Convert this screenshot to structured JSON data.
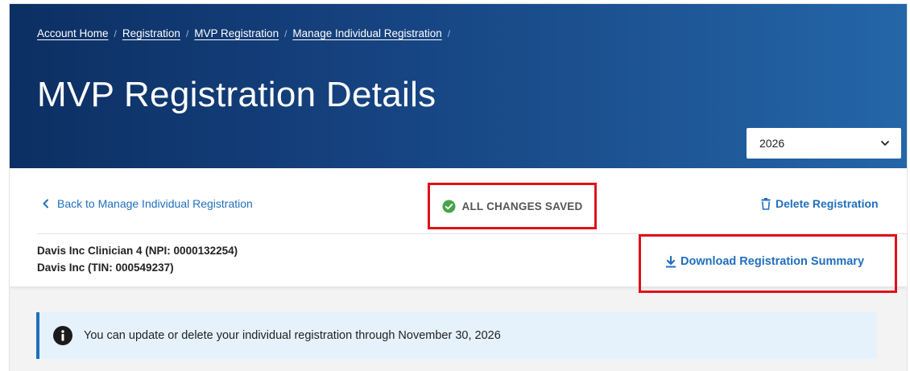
{
  "breadcrumb": {
    "items": [
      "Account Home",
      "Registration",
      "MVP Registration",
      "Manage Individual Registration"
    ],
    "separator": "/"
  },
  "header": {
    "title": "MVP Registration Details",
    "year_select": {
      "selected": "2026"
    }
  },
  "actions": {
    "back_label": "Back to Manage Individual Registration",
    "save_status": "ALL CHANGES SAVED",
    "delete_label": "Delete Registration",
    "download_label": "Download Registration Summary"
  },
  "identity": {
    "clinician": "Davis Inc Clinician 4 (NPI: 0000132254)",
    "tin": "Davis Inc (TIN: 000549237)"
  },
  "alert": {
    "message": "You can update or delete your individual registration through November 30, 2026"
  },
  "colors": {
    "header_dark": "#0c2f63",
    "header_light": "#2466a8",
    "link": "#1f6fbd",
    "success": "#47a34a",
    "highlight": "#e0101a",
    "alert_bg": "#e6f2fb"
  },
  "icons": [
    "chevron-down-icon",
    "chevron-left-icon",
    "check-circle-icon",
    "trash-icon",
    "download-icon",
    "info-icon"
  ]
}
